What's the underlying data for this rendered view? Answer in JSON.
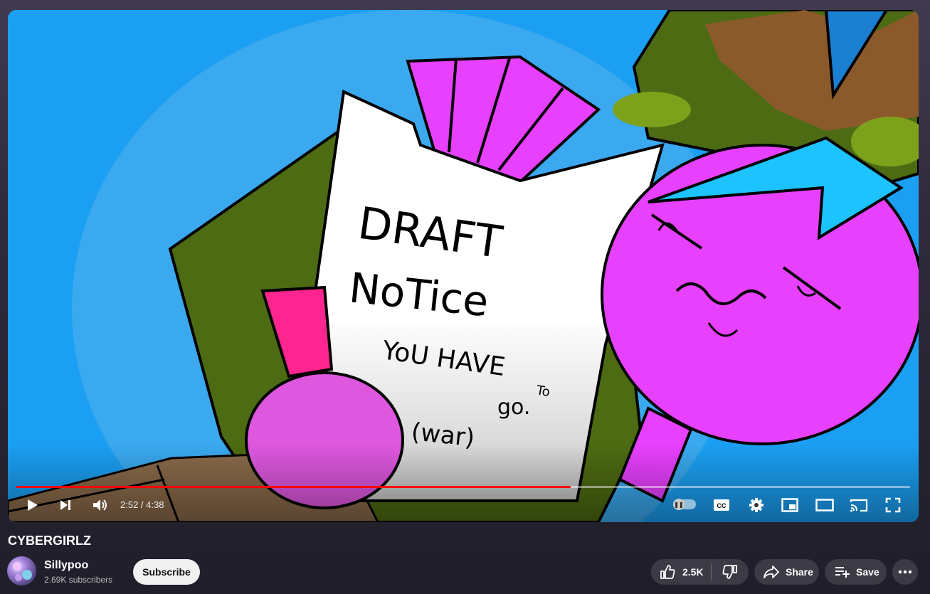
{
  "player": {
    "current_time": "2:52",
    "separator": " / ",
    "duration": "4:38",
    "progress_fraction": 0.6205,
    "progress_color": "#ff0000"
  },
  "video": {
    "title": "CYBERGIRLZ",
    "frame_text": {
      "line1": "DRAFT",
      "line2": "NoTice",
      "line3": "YoU HAVE",
      "line3b": "To",
      "line4": "go.",
      "line5": "(war)"
    }
  },
  "channel": {
    "name": "Sillypoo",
    "subscribers": "2.69K subscribers",
    "subscribe_label": "Subscribe"
  },
  "actions": {
    "like_count": "2.5K",
    "share_label": "Share",
    "save_label": "Save"
  },
  "icons": [
    "play-icon",
    "next-icon",
    "volume-icon",
    "autoplay-toggle",
    "captions-icon",
    "settings-icon",
    "miniplayer-icon",
    "theater-icon",
    "cast-icon",
    "fullscreen-icon",
    "like-icon",
    "dislike-icon",
    "share-icon",
    "save-icon",
    "more-icon"
  ]
}
